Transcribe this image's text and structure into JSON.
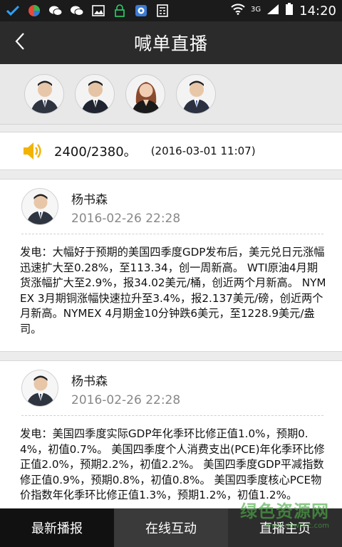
{
  "status_bar": {
    "time": "14:20",
    "network": "3G"
  },
  "header": {
    "title": "喊单直播"
  },
  "avatars": [
    {
      "name": "analyst-1"
    },
    {
      "name": "analyst-2"
    },
    {
      "name": "analyst-3"
    },
    {
      "name": "analyst-4"
    }
  ],
  "ticker": {
    "text": "2400/2380。",
    "time": "(2016-03-01 11:07)"
  },
  "posts": [
    {
      "author": "杨书森",
      "datetime": "2016-02-26  22:28",
      "content": "发电：大幅好于预期的美国四季度GDP发布后，美元兑日元涨幅迅速扩大至0.28%，至113.34，创一周新高。 WTI原油4月期货涨幅扩大至2.9%，报34.02美元/桶，创近两个月新高。 NYMEX 3月期铜涨幅快速拉升至3.4%，报2.137美元/磅，创近两个月新高。NYMEX 4月期金10分钟跌6美元，至1228.9美元/盎司。"
    },
    {
      "author": "杨书森",
      "datetime": "2016-02-26  22:28",
      "content": "发电：美国四季度实际GDP年化季环比修正值1.0%，预期0.4%，初值0.7%。 美国四季度个人消费支出(PCE)年化季环比修正值2.0%，预期2.2%，初值2.2%。 美国四季度GDP平减指数修正值0.9%，预期0.8%，初值0.8%。 美国四季度核心PCE物价指数年化季环比修正值1.3%，预期1.2%，初值1.2%。"
    }
  ],
  "bottom_nav": {
    "tabs": [
      "最新播报",
      "在线互动",
      "直播主页"
    ]
  },
  "watermark": {
    "line1": "绿色资源网",
    "line2": "www.downcc.com"
  }
}
